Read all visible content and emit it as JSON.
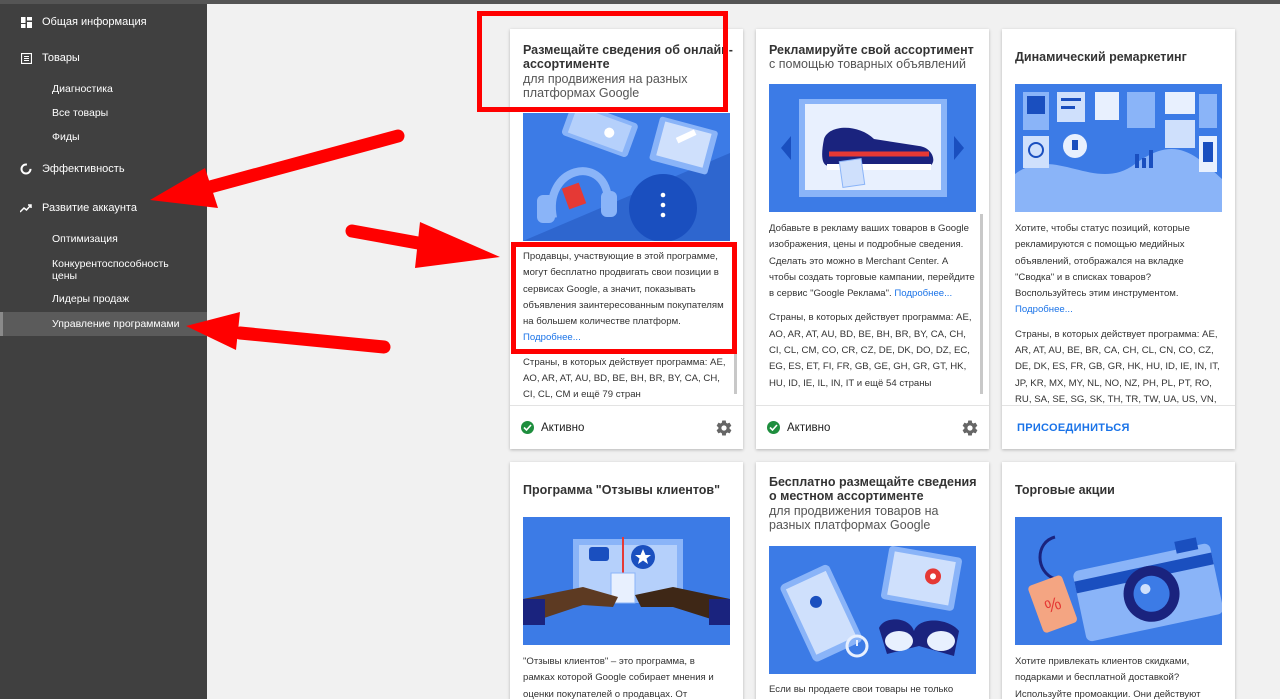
{
  "sidebar": {
    "overview": "Общая информация",
    "products": "Товары",
    "products_items": [
      "Диагностика",
      "Все товары",
      "Фиды"
    ],
    "performance": "Эффективность",
    "growth": "Развитие аккаунта",
    "growth_items": [
      "Оптимизация",
      "Конкурентоспособность цены",
      "Лидеры продаж",
      "Управление программами"
    ]
  },
  "cards": [
    {
      "title": "Размещайте сведения об онлайн-ассортименте",
      "subtitle": "для продвижения на разных платформах Google",
      "desc": "Продавцы, участвующие в этой программе, могут бесплатно продвигать свои позиции в сервисах Google, а значит, показывать объявления заинтересованным покупателям на большем количестве платформ.",
      "more": "Подробнее...",
      "countries": "Страны, в которых действует программа: AE, AO, AR, AT, AU, BD, BE, BH, BR, BY, CA, CH, CI, CL, CM и ещё 79 стран",
      "status": "Активно"
    },
    {
      "title": "Рекламируйте свой ассортимент",
      "subtitle": "с помощью товарных объявлений",
      "desc": "Добавьте в рекламу ваших товаров в Google изображения, цены и подробные сведения. Сделать это можно в Merchant Center. А чтобы создать торговые кампании, перейдите в сервис \"Google Реклама\".",
      "more": "Подробнее...",
      "countries": "Страны, в которых действует программа: AE, AO, AR, AT, AU, BD, BE, BH, BR, BY, CA, CH, CI, CL, CM, CO, CR, CZ, DE, DK, DO, DZ, EC, EG, ES, ET, FI, FR, GB, GE, GH, GR, GT, HK, HU, ID, IE, IL, IN, IT и ещё 54 страны",
      "status": "Активно"
    },
    {
      "title": "Динамический ремаркетинг",
      "desc": "Хотите, чтобы статус позиций, которые рекламируются с помощью медийных объявлений, отображался на вкладке \"Сводка\" и в списках товаров? Воспользуйтесь этим инструментом.",
      "more": "Подробнее...",
      "countries": "Страны, в которых действует программа: AE, AR, AT, AU, BE, BR, CA, CH, CL, CN, CO, CZ, DE, DK, ES, FR, GB, GR, HK, HU, ID, IE, IN, IT, JP, KR, MX, MY, NL, NO, NZ, PH, PL, PT, RO, RU, SA, SE, SG, SK, TH, TR, TW, UA, US, VN, ZA",
      "action": "ПРИСОЕДИНИТЬСЯ"
    },
    {
      "title": "Программа \"Отзывы клиентов\"",
      "desc": "\"Отзывы клиентов\" – это программа, в рамках которой Google собирает мнения и оценки покупателей о продавцах. От"
    },
    {
      "title": "Бесплатно размещайте сведения о местном ассортименте",
      "subtitle": "для продвижения товаров на разных платформах Google",
      "desc": "Если вы продаете свои товары не только"
    },
    {
      "title": "Торговые акции",
      "desc": "Хотите привлекать клиентов скидками, подарками и бесплатной доставкой? Используйте промоакции. Они действуют"
    }
  ],
  "colors": {
    "sidebar_bg": "#404040",
    "accent_blue": "#1a73e8",
    "active_green": "#1e8e3e",
    "highlight_red": "#ff0000",
    "illustration_blue": "#3c7be6"
  }
}
